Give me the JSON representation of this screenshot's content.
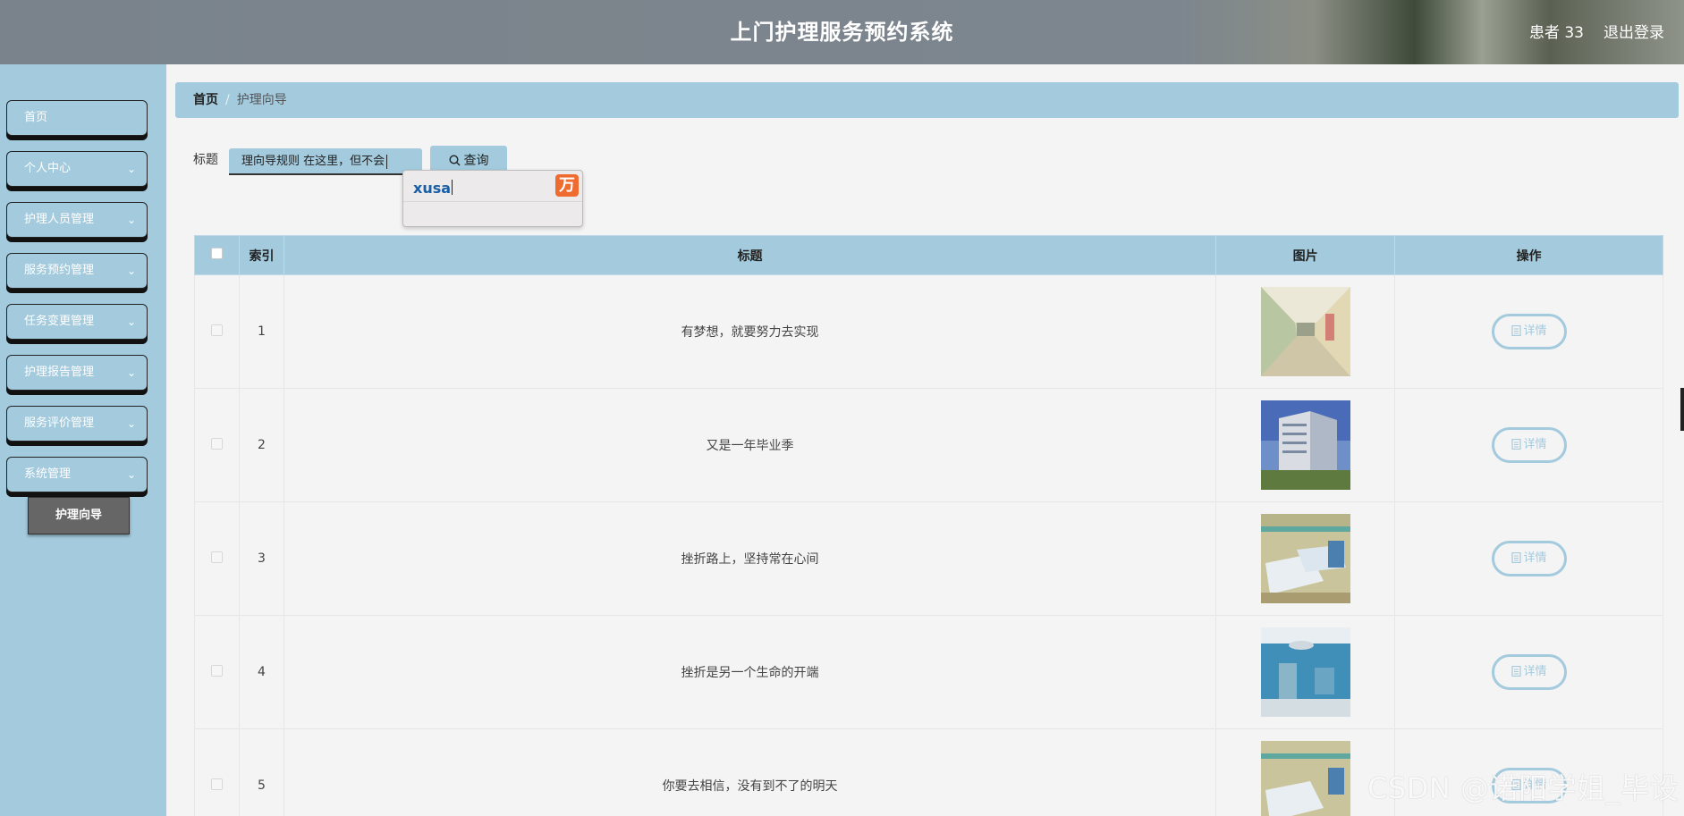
{
  "header": {
    "title": "上门护理服务预约系统",
    "user": "患者 33",
    "logout": "退出登录"
  },
  "sidebar": {
    "items": [
      {
        "label": "首页",
        "has_children": false
      },
      {
        "label": "个人中心",
        "has_children": true
      },
      {
        "label": "护理人员管理",
        "has_children": true
      },
      {
        "label": "服务预约管理",
        "has_children": true
      },
      {
        "label": "任务变更管理",
        "has_children": true
      },
      {
        "label": "护理报告管理",
        "has_children": true
      },
      {
        "label": "服务评价管理",
        "has_children": true
      },
      {
        "label": "系统管理",
        "has_children": true
      }
    ],
    "submenu_active": "护理向导"
  },
  "breadcrumb": {
    "home": "首页",
    "separator": "/",
    "current": "护理向导"
  },
  "search": {
    "label": "标题",
    "value": "理向导规则 在这里，但不会",
    "button": "查询"
  },
  "ime": {
    "composition": "xusa",
    "logo": "万"
  },
  "table": {
    "headers": [
      "",
      "索引",
      "标题",
      "图片",
      "操作"
    ],
    "rows": [
      {
        "index": "1",
        "title": "有梦想，就要努力去实现",
        "image": "hospital-corridor",
        "action": "详情"
      },
      {
        "index": "2",
        "title": "又是一年毕业季",
        "image": "hospital-building",
        "action": "详情"
      },
      {
        "index": "3",
        "title": "挫折路上，坚持常在心间",
        "image": "ward-beds",
        "action": "详情"
      },
      {
        "index": "4",
        "title": "挫折是另一个生命的开端",
        "image": "operating-room",
        "action": "详情"
      },
      {
        "index": "5",
        "title": "你要去相信，没有到不了的明天",
        "image": "ward-beds",
        "action": "详情"
      }
    ]
  },
  "watermark": "CSDN @诺阳学姐_毕设",
  "colors": {
    "accent": "#a3cadd",
    "header": "#7d868e",
    "submenu": "#666666"
  }
}
